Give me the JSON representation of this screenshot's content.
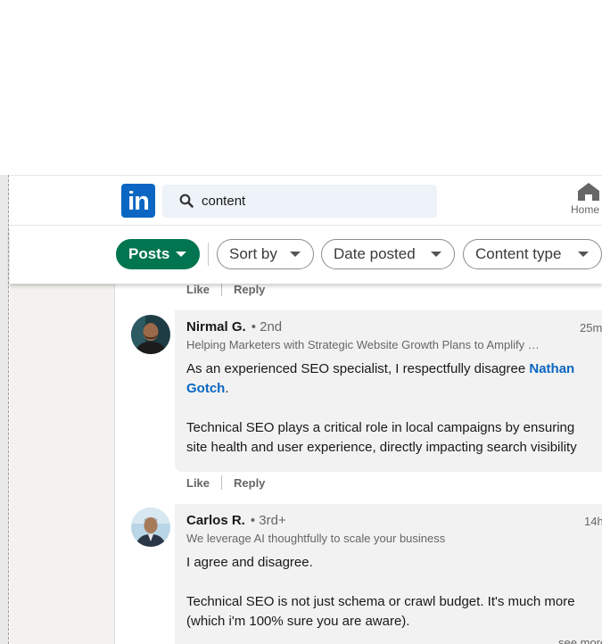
{
  "search": {
    "value": "content"
  },
  "nav": {
    "home_label": "Home"
  },
  "filters": [
    {
      "label": "Posts",
      "active": true
    },
    {
      "label": "Sort by"
    },
    {
      "label": "Date posted"
    },
    {
      "label": "Content type"
    }
  ],
  "actions": {
    "like": "Like",
    "reply": "Reply"
  },
  "comments": [
    {
      "name": "Nirmal G.",
      "degree": "• 2nd",
      "time": "25m",
      "headline": "Helping Marketers with Strategic Website Growth Plans to Amplify …",
      "mention": "Nathan Gotch",
      "text_before_mention": "As an experienced SEO specialist, I respectfully disagree ",
      "mention_line1": "Nathan",
      "mention_line2": "Gotch",
      "text_after_mention": ".",
      "para2_line1": "Technical SEO plays a critical role in local campaigns by ensuring",
      "para2_line2": "site health and user experience, directly impacting search visibility"
    },
    {
      "name": "Carlos R.",
      "degree": "• 3rd+",
      "time": "14h",
      "headline": "We leverage AI thoughtfully to scale your business",
      "para1": "I agree and disagree.",
      "para2_line1": "Technical SEO is not just schema or crawl budget. It's much more",
      "para2_line2": "(which i'm 100% sure you are aware).",
      "see_more": "see more"
    }
  ],
  "colors": {
    "brand": "#0a66c2",
    "active_filter": "#01754f",
    "bubble": "#f2f2f2"
  }
}
